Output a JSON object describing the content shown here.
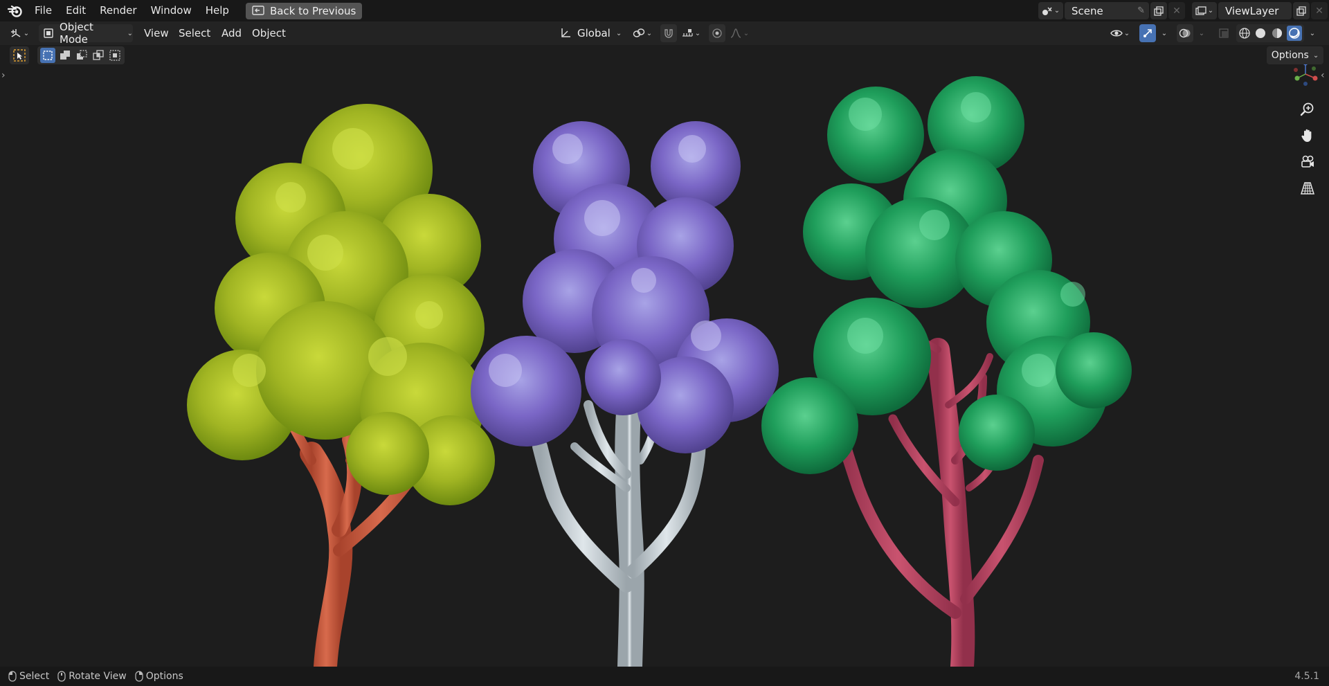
{
  "menu": {
    "file": "File",
    "edit": "Edit",
    "render": "Render",
    "window": "Window",
    "help": "Help"
  },
  "back_button": "Back to Previous",
  "scene": {
    "name": "Scene"
  },
  "view_layer": {
    "name": "ViewLayer"
  },
  "header": {
    "mode": "Object Mode",
    "view": "View",
    "select": "Select",
    "add": "Add",
    "object": "Object",
    "transform_orientation": "Global"
  },
  "tool_options": {
    "options_label": "Options"
  },
  "status": {
    "select": "Select",
    "rotate_view": "Rotate View",
    "options": "Options",
    "version": "4.5.1"
  },
  "colors": {
    "tree_left_foliage": "#9fb21f",
    "tree_left_trunk": "#c65a3e",
    "tree_mid_foliage": "#7a64c0",
    "tree_mid_trunk": "#c9d3d8",
    "tree_right_foliage": "#1f9a5a",
    "tree_right_trunk": "#b8435f",
    "accent": "#4772b3"
  }
}
